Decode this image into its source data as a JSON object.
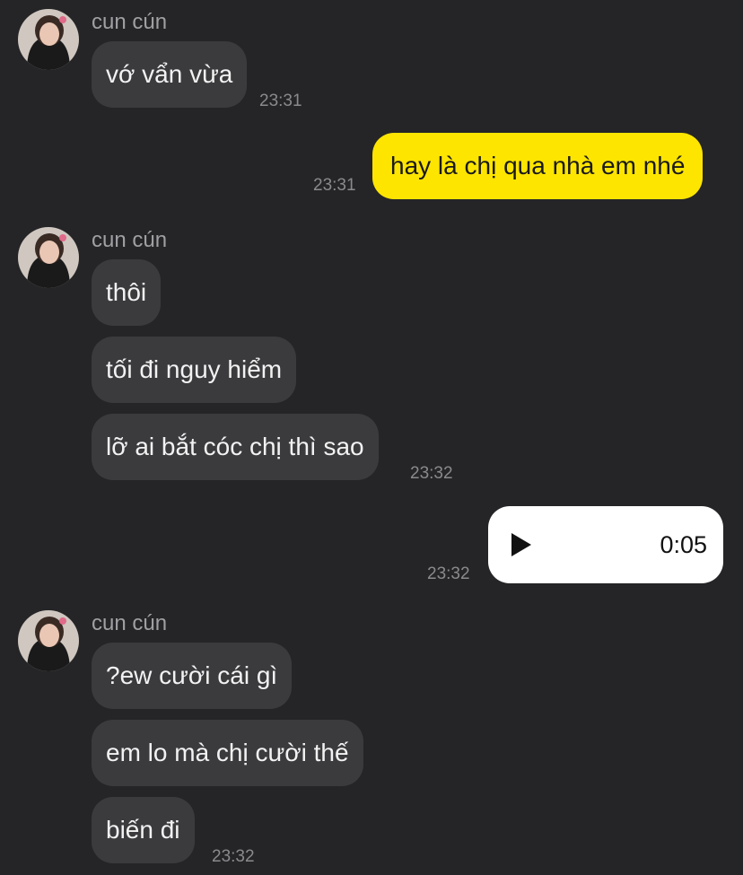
{
  "messages": {
    "group1": {
      "sender": "cun cún",
      "bubbles": [
        "vớ vẩn vừa"
      ],
      "time": "23:31"
    },
    "out1": {
      "text": "hay là chị qua nhà em nhé",
      "time": "23:31"
    },
    "group2": {
      "sender": "cun cún",
      "bubbles": [
        "thôi",
        "tối đi nguy hiểm",
        "lỡ ai bắt cóc chị thì sao"
      ],
      "time": "23:32"
    },
    "out2": {
      "type": "voice",
      "duration": "0:05",
      "time": "23:32"
    },
    "group3": {
      "sender": "cun cún",
      "bubbles": [
        "?ew cười cái gì",
        "em lo mà chị cười thế",
        "biến đi"
      ],
      "time": "23:32"
    }
  },
  "colors": {
    "background": "#252527",
    "incoming_bubble": "#3b3b3e",
    "outgoing_bubble": "#fee500",
    "voice_bubble": "#ffffff"
  },
  "icons": {
    "avatar": "profile-photo",
    "voice": "play-icon"
  }
}
